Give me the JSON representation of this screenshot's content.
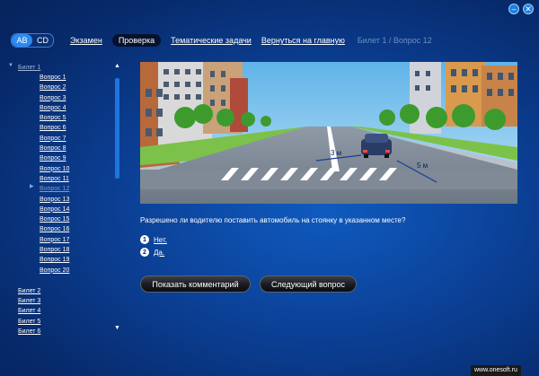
{
  "window": {
    "minimize": "–",
    "close": "✕"
  },
  "toggle": {
    "ab": "AB",
    "cd": "CD"
  },
  "nav": {
    "exam": "Экзамен",
    "check": "Проверка",
    "thematic": "Тематические задачи",
    "home": "Вернуться на главную",
    "status": "Билет 1 / Вопрос 12"
  },
  "sidebar": {
    "current_ticket": "Билет 1",
    "questions": [
      "Вопрос 1",
      "Вопрос 2",
      "Вопрос 3",
      "Вопрос 4",
      "Вопрос 5",
      "Вопрос 6",
      "Вопрос 7",
      "Вопрос 8",
      "Вопрос 9",
      "Вопрос 10",
      "Вопрос 11",
      "Вопрос 12",
      "Вопрос 13",
      "Вопрос 14",
      "Вопрос 15",
      "Вопрос 16",
      "Вопрос 17",
      "Вопрос 18",
      "Вопрос 19",
      "Вопрос 20"
    ],
    "current_question_index": 11,
    "tickets": [
      "Билет 2",
      "Билет 3",
      "Билет 4",
      "Билет 5",
      "Билет 6"
    ]
  },
  "picture": {
    "dist1": "3 м",
    "dist2": "5 м"
  },
  "question": {
    "text": "Разрешено ли водителю поставить автомобиль на стоянку в указанном месте?",
    "answers": [
      {
        "num": "1",
        "text": "Нет."
      },
      {
        "num": "2",
        "text": "Да."
      }
    ]
  },
  "buttons": {
    "comment": "Показать комментарий",
    "next": "Следующий вопрос"
  },
  "watermark": "www.onesoft.ru",
  "colors": {
    "accent": "#2c8af0",
    "background": "#0b3f94"
  }
}
